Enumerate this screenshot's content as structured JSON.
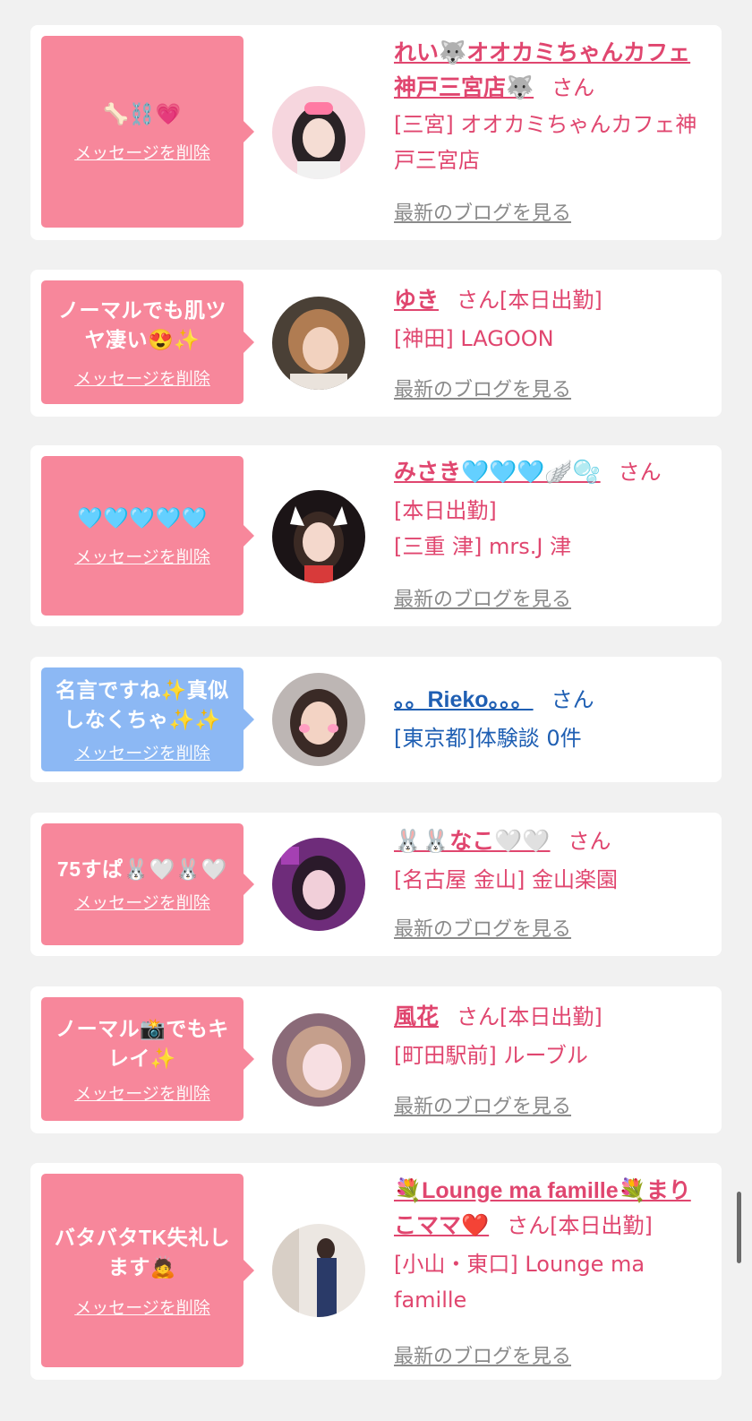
{
  "delete_label": "メッセージを削除",
  "blog_label": "最新のブログを見る",
  "san_label": "さん",
  "colors": {
    "pink": "#f7879b",
    "blue": "#8cb8f4",
    "name_pink": "#e0466f",
    "name_blue": "#1f5fb3"
  },
  "cards": [
    {
      "message": "🦴⛓️💗",
      "name": "れい🐺オオカミちゃんカフェ神戸三宮店🐺",
      "suffix": "",
      "shop": "[三宮] オオカミちゃんカフェ神戸三宮店",
      "has_blog": true
    },
    {
      "message": "ノーマルでも肌ツヤ凄い😍✨",
      "name": "ゆき",
      "suffix": "[本日出勤]",
      "shop": "[神田] LAGOON",
      "has_blog": true
    },
    {
      "message": "🩵🩵🩵🩵🩵",
      "name": "みさき🩵🩵🩵🪽🫧",
      "suffix": "",
      "shop_line1": "[本日出勤]",
      "shop": "[三重 津] mrs.J 津",
      "has_blog": true
    },
    {
      "message": "名言ですね✨真似しなくちゃ✨✨",
      "name": "。。Rieko。。。",
      "suffix": "",
      "shop": "[東京都]体験談 0件",
      "has_blog": false
    },
    {
      "message": "75すぱ🐰🤍🐰🤍",
      "name": "🐰🐰なこ🤍🤍",
      "suffix": "",
      "shop": "[名古屋 金山] 金山楽園",
      "has_blog": true
    },
    {
      "message": "ノーマル📸でもキレイ✨",
      "name": "風花",
      "suffix": "[本日出勤]",
      "shop": "[町田駅前] ルーブル",
      "has_blog": true
    },
    {
      "message": "バタバタTK失礼します🙇",
      "name": "💐Lounge ma famille💐まりこママ❤️",
      "suffix": "[本日出勤]",
      "shop": "[小山・東口] Lounge ma famille",
      "has_blog": true
    }
  ]
}
